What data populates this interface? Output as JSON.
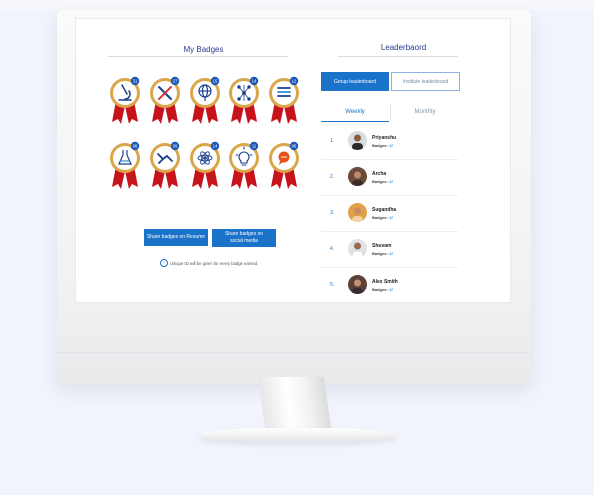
{
  "badges_title": "My Badges",
  "leaderboard_title": "Leaderbaord",
  "badges": [
    {
      "count": "31",
      "icon": "microscope-icon"
    },
    {
      "count": "27",
      "icon": "tools-icon"
    },
    {
      "count": "15",
      "icon": "globe-icon"
    },
    {
      "count": "14",
      "icon": "network-icon"
    },
    {
      "count": "12",
      "icon": "books-icon"
    },
    {
      "count": "08",
      "icon": "flask-icon"
    },
    {
      "count": "09",
      "icon": "handshake-icon"
    },
    {
      "count": "14",
      "icon": "atom-icon"
    },
    {
      "count": "11",
      "icon": "lightbulb-icon"
    },
    {
      "count": "06",
      "icon": "chat-icon"
    }
  ],
  "buttons": {
    "share_resume": "Share badges on Resume",
    "share_social_line1": "Share badges on",
    "share_social_line2": "social media"
  },
  "note": "Unique ID will be given for every badge earned.",
  "tabs": {
    "group": "Group leaderboard",
    "institute": "Institute leaderboard",
    "weekly": "Weekly",
    "monthly": "Monthly"
  },
  "leaderboard": [
    {
      "rank": "1.",
      "name": "Priyanshu",
      "badges_label": "Badges:",
      "badges": "42"
    },
    {
      "rank": "2.",
      "name": "Archa",
      "badges_label": "Badges:",
      "badges": "42"
    },
    {
      "rank": "3.",
      "name": "Sugandha",
      "badges_label": "Badges:",
      "badges": "42"
    },
    {
      "rank": "4.",
      "name": "Shuvam",
      "badges_label": "Badges:",
      "badges": "42"
    },
    {
      "rank": "5.",
      "name": "Alex Smith",
      "badges_label": "Badges:",
      "badges": "42"
    }
  ],
  "colors": {
    "accent": "#1a72c9",
    "title": "#2a3b8f",
    "ribbon": "#c8121c",
    "gold": "#d9a74a"
  }
}
